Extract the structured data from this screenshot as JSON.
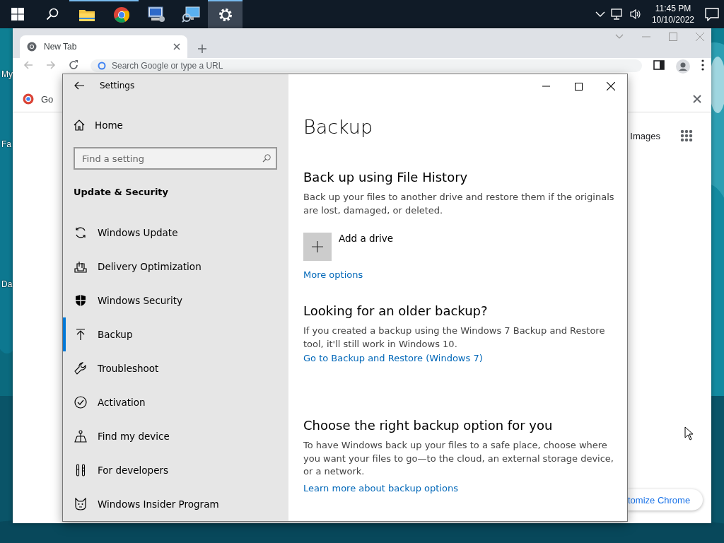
{
  "desktop": {
    "icons": [
      {
        "label": "My"
      },
      {
        "label": "Fa"
      },
      {
        "label": "Da"
      }
    ]
  },
  "taskbar": {
    "apps": [
      {
        "kind": "file-explorer",
        "running": true,
        "selected": false
      },
      {
        "kind": "chrome",
        "running": true,
        "selected": false
      },
      {
        "kind": "computer",
        "running": false,
        "selected": false
      },
      {
        "kind": "monitor",
        "running": false,
        "selected": false
      },
      {
        "kind": "settings",
        "running": true,
        "selected": true
      }
    ],
    "clock": {
      "time": "11:45 PM",
      "date": "10/10/2022"
    }
  },
  "chrome": {
    "tab": {
      "title": "New Tab"
    },
    "address": {
      "placeholder": "Search Google or type a URL"
    },
    "bookmark": {
      "label": "Go"
    },
    "page": {
      "links": [
        "Images"
      ],
      "customize_button": "tomize Chrome"
    }
  },
  "settings": {
    "window": {
      "title": "Settings"
    },
    "home": "Home",
    "search": {
      "placeholder": "Find a setting"
    },
    "section_title": "Update & Security",
    "nav_items": [
      {
        "kind": "sync",
        "label": "Windows Update",
        "selected": false
      },
      {
        "kind": "delivery",
        "label": "Delivery Optimization",
        "selected": false
      },
      {
        "kind": "shield",
        "label": "Windows Security",
        "selected": false
      },
      {
        "kind": "backup",
        "label": "Backup",
        "selected": true
      },
      {
        "kind": "wrench",
        "label": "Troubleshoot",
        "selected": false
      },
      {
        "kind": "check",
        "label": "Activation",
        "selected": false
      },
      {
        "kind": "find",
        "label": "Find my device",
        "selected": false
      },
      {
        "kind": "tools",
        "label": "For developers",
        "selected": false
      },
      {
        "kind": "insider",
        "label": "Windows Insider Program",
        "selected": false
      }
    ],
    "page_title": "Backup",
    "sections": [
      {
        "title": "Back up using File History",
        "description": "Back up your files to another drive and restore them if the originals are lost, damaged, or deleted.",
        "add_button": "Add a drive",
        "link": "More options"
      },
      {
        "title": "Looking for an older backup?",
        "description": "If you created a backup using the Windows 7 Backup and Restore tool, it'll still work in Windows 10.",
        "link": "Go to Backup and Restore (Windows 7)"
      },
      {
        "title": "Choose the right backup option for you",
        "description": "To have Windows back up your files to a safe place, choose where you want your files to go—to the cloud, an external storage device, or a network.",
        "link": "Learn more about backup options"
      }
    ]
  }
}
